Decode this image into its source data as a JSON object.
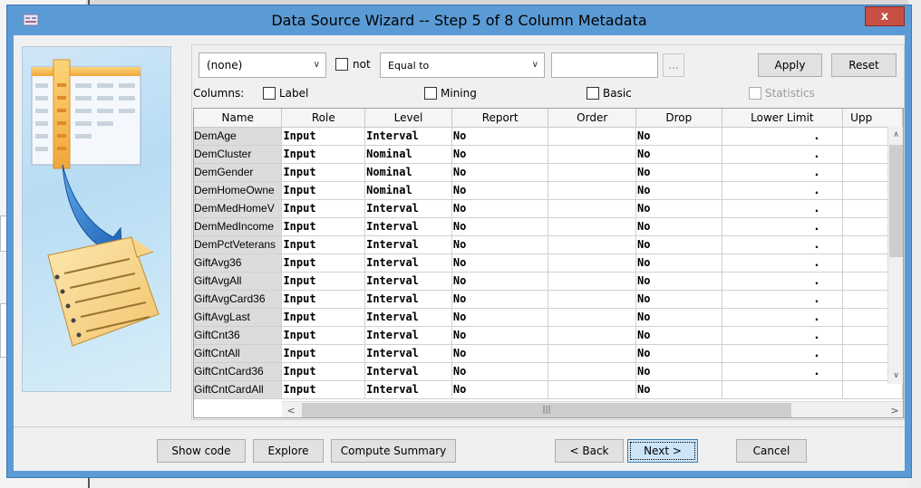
{
  "window": {
    "title": "Data Source Wizard  -- Step 5 of 8  Column Metadata",
    "close_label": "x"
  },
  "filter": {
    "column_select": "(none)",
    "not_label": "not",
    "operator_select": "Equal to",
    "value_input": "",
    "browse_label": "...",
    "apply_label": "Apply",
    "reset_label": "Reset"
  },
  "columns_options": {
    "label": "Columns:",
    "options": [
      {
        "label": "Label",
        "checked": false,
        "enabled": true
      },
      {
        "label": "Mining",
        "checked": false,
        "enabled": true
      },
      {
        "label": "Basic",
        "checked": false,
        "enabled": true
      },
      {
        "label": "Statistics",
        "checked": false,
        "enabled": false
      }
    ]
  },
  "grid": {
    "headers": [
      "Name",
      "Role",
      "Level",
      "Report",
      "Order",
      "Drop",
      "Lower Limit",
      "Upp"
    ],
    "rows": [
      [
        "DemAge",
        "Input",
        "Interval",
        "No",
        "",
        "No",
        "."
      ],
      [
        "DemCluster",
        "Input",
        "Nominal",
        "No",
        "",
        "No",
        "."
      ],
      [
        "DemGender",
        "Input",
        "Nominal",
        "No",
        "",
        "No",
        "."
      ],
      [
        "DemHomeOwne",
        "Input",
        "Nominal",
        "No",
        "",
        "No",
        "."
      ],
      [
        "DemMedHomeV",
        "Input",
        "Interval",
        "No",
        "",
        "No",
        "."
      ],
      [
        "DemMedIncome",
        "Input",
        "Interval",
        "No",
        "",
        "No",
        "."
      ],
      [
        "DemPctVeterans",
        "Input",
        "Interval",
        "No",
        "",
        "No",
        "."
      ],
      [
        "GiftAvg36",
        "Input",
        "Interval",
        "No",
        "",
        "No",
        "."
      ],
      [
        "GiftAvgAll",
        "Input",
        "Interval",
        "No",
        "",
        "No",
        "."
      ],
      [
        "GiftAvgCard36",
        "Input",
        "Interval",
        "No",
        "",
        "No",
        "."
      ],
      [
        "GiftAvgLast",
        "Input",
        "Interval",
        "No",
        "",
        "No",
        "."
      ],
      [
        "GiftCnt36",
        "Input",
        "Interval",
        "No",
        "",
        "No",
        "."
      ],
      [
        "GiftCntAll",
        "Input",
        "Interval",
        "No",
        "",
        "No",
        "."
      ],
      [
        "GiftCntCard36",
        "Input",
        "Interval",
        "No",
        "",
        "No",
        "."
      ],
      [
        "GiftCntCardAll",
        "Input",
        "Interval",
        "No",
        "",
        "No",
        ""
      ]
    ]
  },
  "footer": {
    "show_code": "Show code",
    "explore": "Explore",
    "compute_summary": "Compute Summary",
    "back": "< Back",
    "next": "Next >",
    "cancel": "Cancel"
  },
  "colors": {
    "titlebar": "#5b9bd5",
    "close": "#c74f43",
    "name_cell": "#dcdcdc"
  }
}
